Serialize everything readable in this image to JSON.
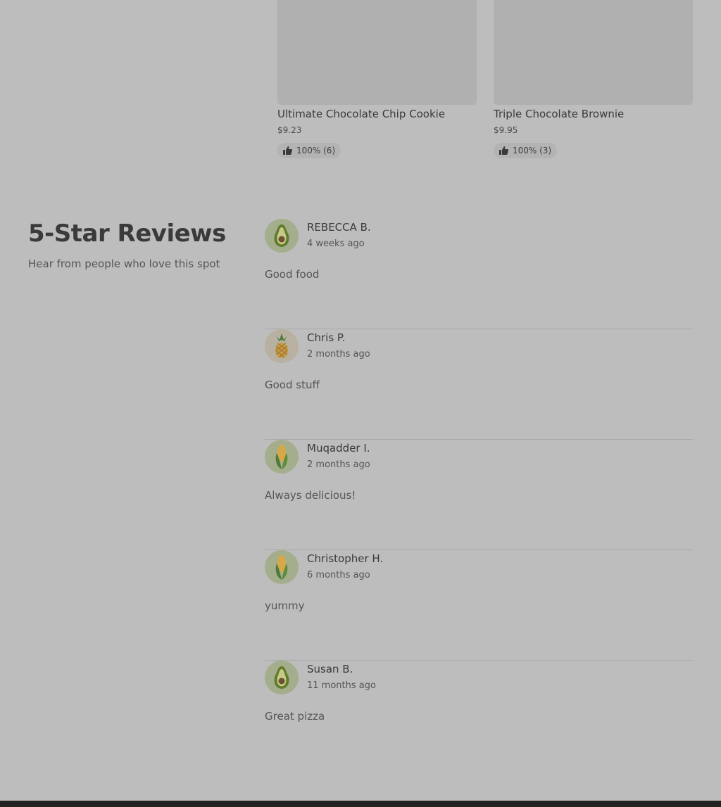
{
  "products": [
    {
      "title": "Ultimate Chocolate Chip Cookie",
      "price": "$9.23",
      "rating": "100% (6)"
    },
    {
      "title": "Triple Chocolate Brownie",
      "price": "$9.95",
      "rating": "100% (3)"
    }
  ],
  "reviews_section": {
    "title": "5-Star Reviews",
    "subtitle": "Hear from people who love this spot"
  },
  "reviews": [
    {
      "name": "REBECCA B.",
      "date": "4 weeks ago",
      "text": "Good food",
      "avatar_icon": "avocado-icon"
    },
    {
      "name": "Chris P.",
      "date": "2 months ago",
      "text": "Good stuff",
      "avatar_icon": "pineapple-icon"
    },
    {
      "name": "Muqadder I.",
      "date": "2 months ago",
      "text": "Always delicious!",
      "avatar_icon": "corn-icon"
    },
    {
      "name": "Christopher H.",
      "date": "6 months ago",
      "text": "yummy",
      "avatar_icon": "corn-icon"
    },
    {
      "name": "Susan B.",
      "date": "11 months ago",
      "text": "Great pizza",
      "avatar_icon": "avocado-icon"
    }
  ]
}
